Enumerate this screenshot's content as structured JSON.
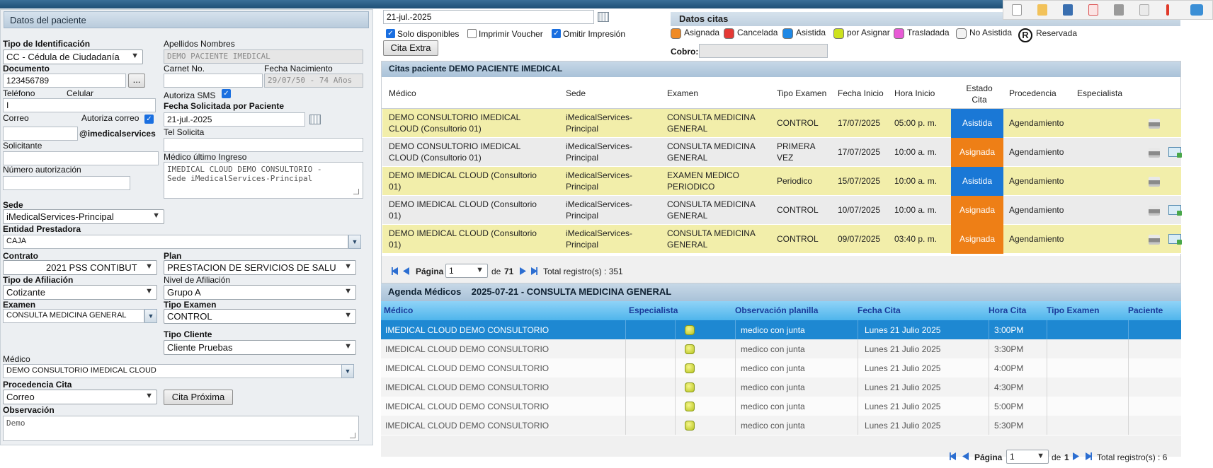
{
  "patient_form": {
    "title": "Datos del paciente",
    "tipo_identificacion": {
      "label": "Tipo de Identificación",
      "value": "CC - Cédula de Ciudadanía"
    },
    "apellidos_nombres": {
      "label": "Apellidos Nombres",
      "value": "DEMO  PACIENTE IMEDICAL"
    },
    "documento": {
      "label": "Documento",
      "value": "123456789",
      "lookup": "..."
    },
    "carnet": {
      "label": "Carnet No.",
      "value": ""
    },
    "fecha_nacimiento": {
      "label": "Fecha Nacimiento",
      "value": "29/07/50 - 74  Años"
    },
    "telefono": {
      "label": "Teléfono",
      "value": "I"
    },
    "celular": {
      "label": "Celular",
      "value": ""
    },
    "autoriza_sms": {
      "label": "Autoriza SMS",
      "checked": true
    },
    "fecha_solicitada": {
      "label": "Fecha Solicitada por Paciente",
      "value": "21-jul.-2025"
    },
    "correo": {
      "label": "Correo",
      "value": ""
    },
    "autoriza_correo": {
      "label": "Autoriza correo",
      "checked": true
    },
    "correo_domain": "@imedicalservices",
    "tel_solicita": {
      "label": "Tel Solicita",
      "value": ""
    },
    "solicitante": {
      "label": "Solicitante",
      "value": ""
    },
    "medico_ultimo_ingreso": {
      "label": "Médico último Ingreso",
      "value": "IMEDICAL CLOUD DEMO CONSULTORIO -\nSede iMedicalServices-Principal"
    },
    "numero_autorizacion": {
      "label": "Número autorización",
      "value": ""
    },
    "sede": {
      "label": "Sede",
      "value": "iMedicalServices-Principal"
    },
    "entidad_prestadora": {
      "label": "Entidad Prestadora",
      "value": "CAJA"
    },
    "contrato": {
      "label": "Contrato",
      "value": "2021 PSS CONTIBUT"
    },
    "plan": {
      "label": "Plan",
      "value": "PRESTACION DE SERVICIOS DE SALU"
    },
    "tipo_afiliacion": {
      "label": "Tipo de Afiliación",
      "value": "Cotizante"
    },
    "nivel_afiliacion": {
      "label": "Nivel de Afiliación",
      "value": "Grupo A"
    },
    "examen": {
      "label": "Examen",
      "value": "CONSULTA MEDICINA GENERAL"
    },
    "tipo_examen": {
      "label": "Tipo Examen",
      "value": "CONTROL"
    },
    "tipo_cliente": {
      "label": "Tipo Cliente",
      "value": "Cliente Pruebas"
    },
    "medico": {
      "label": "Médico",
      "value": "DEMO CONSULTORIO IMEDICAL CLOUD"
    },
    "procedencia_cita": {
      "label": "Procedencia Cita",
      "value": "Correo"
    },
    "cita_proxima_label": "Cita Próxima",
    "observacion": {
      "label": "Observación",
      "value": "Demo"
    }
  },
  "search": {
    "date": "21-jul.-2025",
    "solo_disponibles": {
      "label": "Solo disponibles",
      "checked": true
    },
    "imprimir_voucher": {
      "label": "Imprimir Voucher",
      "checked": false
    },
    "omitir_impresion": {
      "label": "Omitir Impresión",
      "checked": true
    },
    "cita_extra_label": "Cita Extra"
  },
  "legend": {
    "title": "Datos citas",
    "items": [
      {
        "label": "Asignada",
        "color": "#f08a24"
      },
      {
        "label": "Cancelada",
        "color": "#e53935"
      },
      {
        "label": "Asistida",
        "color": "#1e88e5"
      },
      {
        "label": "por Asignar",
        "color": "#cde21e"
      },
      {
        "label": "Trasladada",
        "color": "#e85ad6"
      },
      {
        "label": "No Asistida",
        "color": "#f2f2f2"
      }
    ],
    "reservada": {
      "symbol": "R",
      "label": "Reservada"
    },
    "cobro_label": "Cobro:",
    "cobro_value": ""
  },
  "toolbar_icons": [
    "new-document-icon",
    "bookmark-icon",
    "save-icon",
    "close-document-icon",
    "printer-icon",
    "print-preview-icon",
    "alert-icon",
    "chat-icon"
  ],
  "citas": {
    "title": "Citas paciente DEMO PACIENTE IMEDICAL",
    "columns": {
      "medico": "Médico",
      "sede": "Sede",
      "examen": "Examen",
      "tipo_examen": "Tipo Examen",
      "fecha_inicio": "Fecha Inicio",
      "hora_inicio": "Hora Inicio",
      "estado_cita": "Estado Cita",
      "procedencia": "Procedencia",
      "especialista": "Especialista"
    },
    "rows": [
      {
        "medico": "DEMO CONSULTORIO IMEDICAL CLOUD (Consultorio 01)",
        "sede": "iMedicalServices-Principal",
        "examen": "CONSULTA MEDICINA GENERAL",
        "tipo": "CONTROL",
        "fecha": "17/07/2025",
        "hora": "05:00 p. m.",
        "estado": "Asistida",
        "estado_color": "#1a78d6",
        "procedencia": "Agendamiento",
        "bg": "yellow",
        "mail": false
      },
      {
        "medico": "DEMO CONSULTORIO IMEDICAL CLOUD (Consultorio 01)",
        "sede": "iMedicalServices-Principal",
        "examen": "CONSULTA MEDICINA GENERAL",
        "tipo": "PRIMERA VEZ",
        "fecha": "17/07/2025",
        "hora": "10:00 a. m.",
        "estado": "Asignada",
        "estado_color": "#ee7f16",
        "procedencia": "Agendamiento",
        "bg": "grey",
        "mail": true
      },
      {
        "medico": "DEMO IMEDICAL CLOUD (Consultorio 01)",
        "sede": "iMedicalServices-Principal",
        "examen": "EXAMEN MEDICO PERIODICO",
        "tipo": "Periodico",
        "fecha": "15/07/2025",
        "hora": "10:00 a. m.",
        "estado": "Asistida",
        "estado_color": "#1a78d6",
        "procedencia": "Agendamiento",
        "bg": "yellow",
        "mail": false
      },
      {
        "medico": "DEMO IMEDICAL CLOUD (Consultorio 01)",
        "sede": "iMedicalServices-Principal",
        "examen": "CONSULTA MEDICINA GENERAL",
        "tipo": "CONTROL",
        "fecha": "10/07/2025",
        "hora": "10:00 a. m.",
        "estado": "Asignada",
        "estado_color": "#ee7f16",
        "procedencia": "Agendamiento",
        "bg": "grey",
        "mail": true
      },
      {
        "medico": "DEMO IMEDICAL CLOUD (Consultorio 01)",
        "sede": "iMedicalServices-Principal",
        "examen": "CONSULTA MEDICINA GENERAL",
        "tipo": "CONTROL",
        "fecha": "09/07/2025",
        "hora": "03:40 p. m.",
        "estado": "Asignada",
        "estado_color": "#ee7f16",
        "procedencia": "Agendamiento",
        "bg": "yellow",
        "mail": true
      }
    ],
    "pager": {
      "label": "Página",
      "page": "1",
      "of_label": "de",
      "total_pages": "71",
      "total_label": "Total registro(s) : 351"
    }
  },
  "agenda": {
    "title": "Agenda Médicos    2025-07-21 - CONSULTA MEDICINA GENERAL",
    "columns": {
      "medico": "Médico",
      "especialista": "Especialista",
      "observacion": "Observación planilla",
      "fecha": "Fecha Cita",
      "hora": "Hora Cita",
      "tipo": "Tipo Examen",
      "paciente": "Paciente"
    },
    "rows": [
      {
        "medico": "IMEDICAL CLOUD DEMO CONSULTORIO",
        "observacion": "medico con junta",
        "fecha": "Lunes 21 Julio 2025",
        "hora": "3:00PM",
        "selected": true
      },
      {
        "medico": "IMEDICAL CLOUD DEMO CONSULTORIO",
        "observacion": "medico con junta",
        "fecha": "Lunes 21 Julio 2025",
        "hora": "3:30PM",
        "selected": false
      },
      {
        "medico": "IMEDICAL CLOUD DEMO CONSULTORIO",
        "observacion": "medico con junta",
        "fecha": "Lunes 21 Julio 2025",
        "hora": "4:00PM",
        "selected": false
      },
      {
        "medico": "IMEDICAL CLOUD DEMO CONSULTORIO",
        "observacion": "medico con junta",
        "fecha": "Lunes 21 Julio 2025",
        "hora": "4:30PM",
        "selected": false
      },
      {
        "medico": "IMEDICAL CLOUD DEMO CONSULTORIO",
        "observacion": "medico con junta",
        "fecha": "Lunes 21 Julio 2025",
        "hora": "5:00PM",
        "selected": false
      },
      {
        "medico": "IMEDICAL CLOUD DEMO CONSULTORIO",
        "observacion": "medico con junta",
        "fecha": "Lunes 21 Julio 2025",
        "hora": "5:30PM",
        "selected": false
      }
    ],
    "pager": {
      "label": "Página",
      "page": "1",
      "of_label": "de",
      "total_pages": "1",
      "total_label": "Total registro(s) : 6"
    }
  }
}
